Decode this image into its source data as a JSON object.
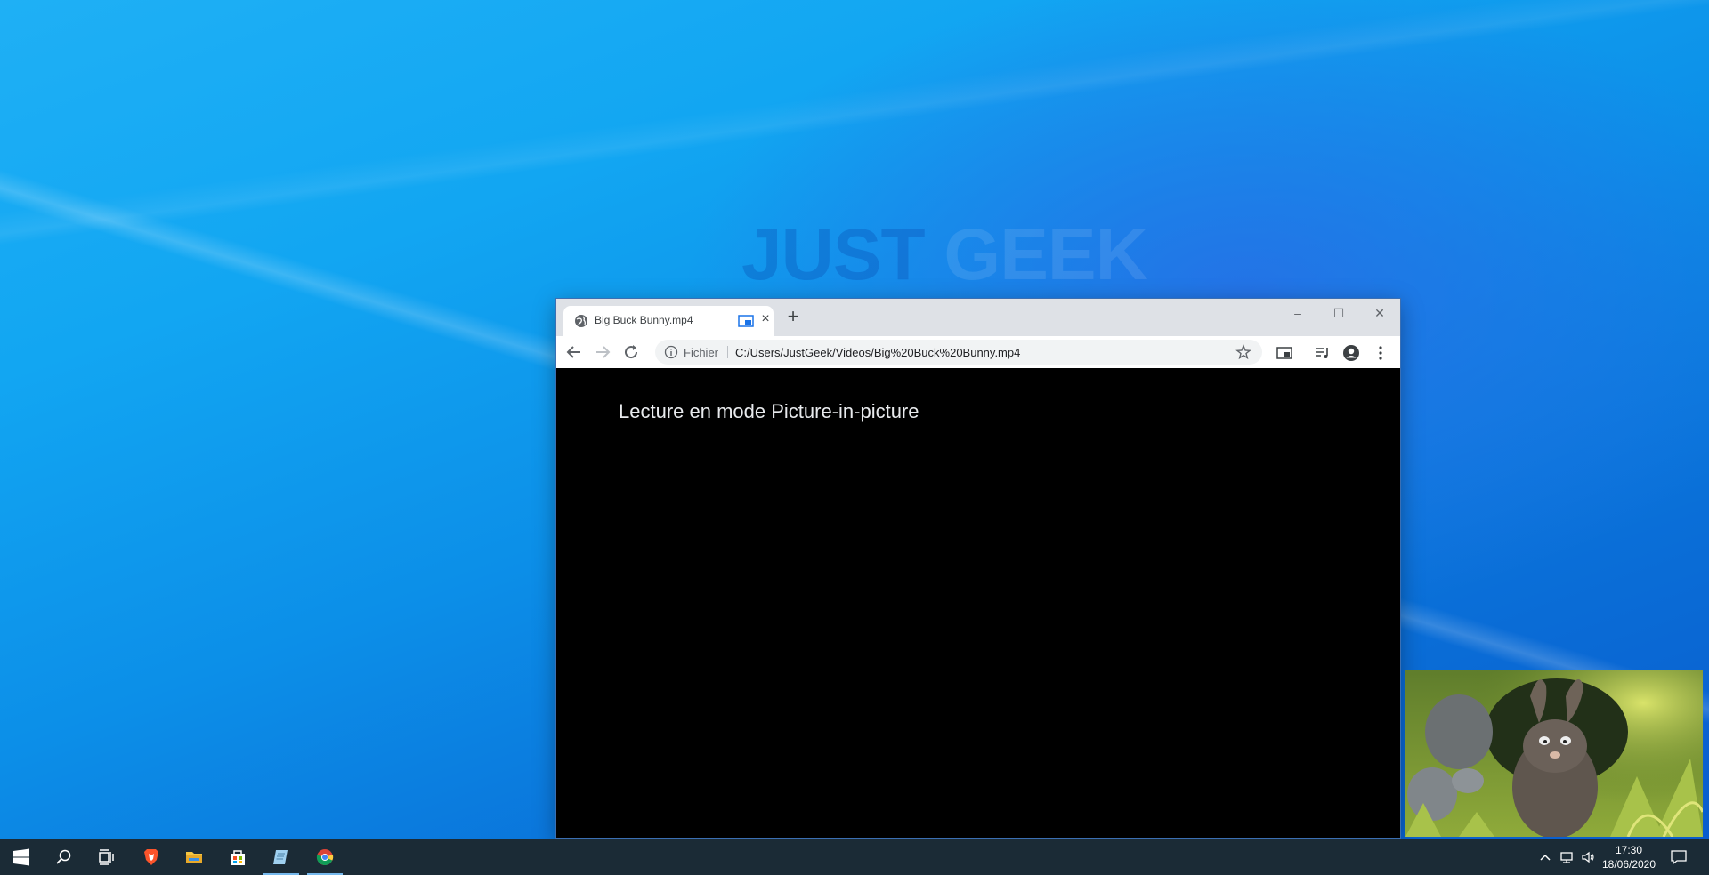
{
  "desktop": {
    "watermark_part1": "JUST",
    "watermark_part2": "GEEK"
  },
  "browser": {
    "tab_title": "Big Buck Bunny.mp4",
    "tab_close": "×",
    "new_tab": "+",
    "window_controls": {
      "minimize": "–",
      "maximize": "☐",
      "close": "✕"
    },
    "origin_label": "Fichier",
    "url": "C:/Users/JustGeek/Videos/Big%20Buck%20Bunny.mp4",
    "content_message": "Lecture en mode Picture-in-picture"
  },
  "taskbar": {
    "time": "17:30",
    "date": "18/06/2020",
    "apps": [
      "start-icon",
      "search-icon",
      "task-view-icon",
      "brave-icon",
      "file-explorer-icon",
      "store-icon",
      "notepad-icon",
      "chrome-icon"
    ]
  },
  "colors": {
    "taskbar_bg": "#1b2b36",
    "accent_line": "#76b9ed",
    "chrome_frame": "#dee1e6"
  }
}
